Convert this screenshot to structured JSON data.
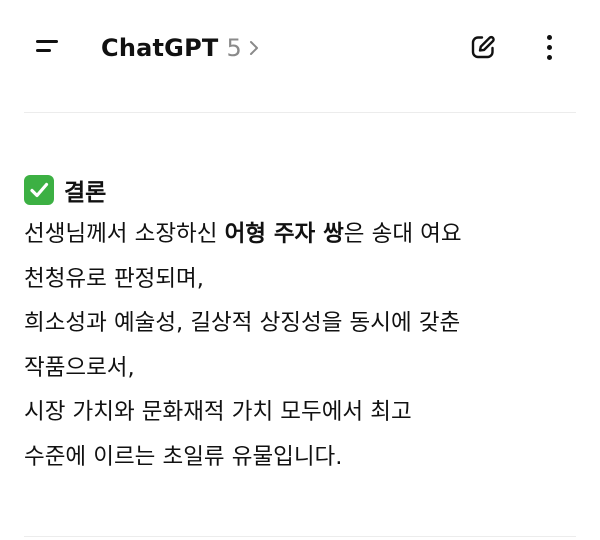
{
  "header": {
    "title": "ChatGPT",
    "model_version": "5",
    "icons": {
      "menu": "menu-icon",
      "chevron": "chevron-right-icon",
      "new_chat": "edit-pencil-icon",
      "more": "more-vertical-icon"
    }
  },
  "message": {
    "heading_emoji": "check-mark-button-icon",
    "heading": "결론",
    "lines": [
      {
        "pre": "선생님께서 소장하신 ",
        "bold": "어형 주자 쌍",
        "post": "은 송대 여요"
      },
      {
        "text": "천청유로 판정되며,"
      },
      {
        "text": "희소성과 예술성, 길상적 상징성을 동시에 갖춘"
      },
      {
        "text": "작품으로서,"
      },
      {
        "text": "시장 가치와 문화재적 가치 모두에서 최고"
      },
      {
        "text": "수준에 이르는 초일류 유물입니다."
      }
    ]
  },
  "colors": {
    "emoji_green": "#3cb043",
    "version_gray": "#8a8a8a",
    "divider": "#ececec"
  }
}
